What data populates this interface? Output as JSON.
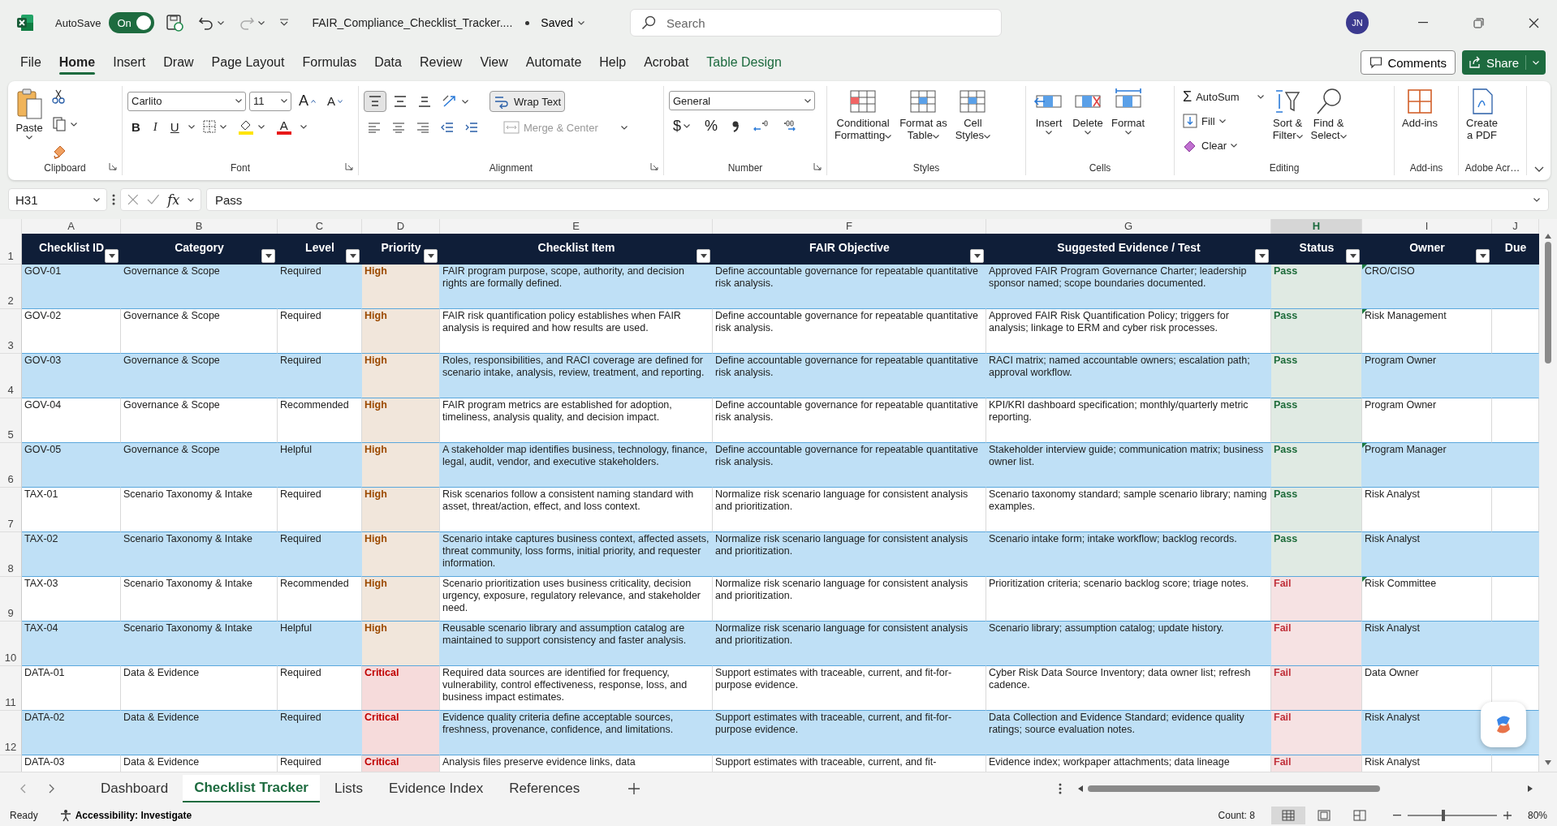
{
  "title_bar": {
    "autosave_label": "AutoSave",
    "autosave": {
      "on": true,
      "label": "On"
    },
    "file_name": "FAIR_Compliance_Checklist_Tracker....",
    "save_status": "Saved",
    "search_placeholder": "Search",
    "avatar_initials": "JN"
  },
  "menu_tabs": [
    {
      "label": "File",
      "selected": false,
      "kind": "standard"
    },
    {
      "label": "Home",
      "selected": true,
      "kind": "standard"
    },
    {
      "label": "Insert",
      "selected": false,
      "kind": "standard"
    },
    {
      "label": "Draw",
      "selected": false,
      "kind": "standard"
    },
    {
      "label": "Page Layout",
      "selected": false,
      "kind": "standard"
    },
    {
      "label": "Formulas",
      "selected": false,
      "kind": "standard"
    },
    {
      "label": "Data",
      "selected": false,
      "kind": "standard"
    },
    {
      "label": "Review",
      "selected": false,
      "kind": "standard"
    },
    {
      "label": "View",
      "selected": false,
      "kind": "standard"
    },
    {
      "label": "Automate",
      "selected": false,
      "kind": "standard"
    },
    {
      "label": "Help",
      "selected": false,
      "kind": "standard"
    },
    {
      "label": "Acrobat",
      "selected": false,
      "kind": "standard"
    },
    {
      "label": "Table Design",
      "selected": false,
      "kind": "contextual"
    }
  ],
  "comments_button": "Comments",
  "share_button": "Share",
  "ribbon": {
    "clipboard": {
      "group": "Clipboard",
      "paste": "Paste"
    },
    "font": {
      "group": "Font",
      "font_name": "Carlito",
      "font_size": "11",
      "grow": "A",
      "shrink": "A",
      "bold": "B",
      "italic": "I",
      "underline": "U",
      "font_color": "A"
    },
    "alignment": {
      "group": "Alignment",
      "vertical_align": [
        {
          "selected": true
        },
        {
          "selected": false
        },
        {
          "selected": false
        }
      ],
      "wrap_text": {
        "label": "Wrap Text",
        "on": true
      },
      "merge": {
        "label": "Merge & Center",
        "disabled": true
      }
    },
    "number": {
      "group": "Number",
      "format": "General",
      "currency": "$",
      "percent": "%"
    },
    "styles": {
      "group": "Styles",
      "buttons": [
        {
          "lines": [
            "Conditional",
            "Formatting"
          ]
        },
        {
          "lines": [
            "Format as",
            "Table"
          ]
        },
        {
          "lines": [
            "Cell",
            "Styles"
          ]
        }
      ]
    },
    "cells": {
      "group": "Cells",
      "buttons": [
        "Insert",
        "Delete",
        "Format"
      ]
    },
    "editing": {
      "group": "Editing",
      "autosum_symbol": "Σ",
      "autosum": "AutoSum",
      "fill": "Fill",
      "clear": "Clear",
      "sort": [
        "Sort &",
        "Filter"
      ],
      "find": [
        "Find &",
        "Select"
      ]
    },
    "addins": {
      "group": "Add-ins",
      "button": "Add-ins"
    },
    "adobe": {
      "group": "Adobe Acr…",
      "button": [
        "Create",
        "a PDF"
      ]
    }
  },
  "formula_bar": {
    "cell": "H31",
    "fx": "fx",
    "value": "Pass"
  },
  "columns": [
    {
      "letter": "A",
      "selected": false
    },
    {
      "letter": "B",
      "selected": false
    },
    {
      "letter": "C",
      "selected": false
    },
    {
      "letter": "D",
      "selected": false
    },
    {
      "letter": "E",
      "selected": false
    },
    {
      "letter": "F",
      "selected": false
    },
    {
      "letter": "G",
      "selected": false
    },
    {
      "letter": "H",
      "selected": true
    },
    {
      "letter": "I",
      "selected": false
    },
    {
      "letter": "J",
      "selected": false
    }
  ],
  "table": {
    "header_row": "1",
    "headers": [
      {
        "label": "Checklist ID",
        "filter": true
      },
      {
        "label": "Category",
        "filter": true
      },
      {
        "label": "Level",
        "filter": true
      },
      {
        "label": "Priority",
        "filter": true
      },
      {
        "label": "Checklist Item",
        "filter": true
      },
      {
        "label": "FAIR Objective",
        "filter": true
      },
      {
        "label": "Suggested Evidence / Test",
        "filter": true
      },
      {
        "label": "Status",
        "filter": true
      },
      {
        "label": "Owner",
        "filter": true
      },
      {
        "label": "Due",
        "filter": false
      }
    ],
    "rows": [
      {
        "row": "2",
        "id": "GOV-01",
        "category": "Governance & Scope",
        "level": "Required",
        "priority": {
          "text": "High",
          "color": "#9c4a00"
        },
        "item": "FAIR program purpose, scope, authority, and decision rights are formally defined.",
        "objective": "Define accountable governance for repeatable quantitative risk analysis.",
        "evidence": "Approved FAIR Program Governance Charter; leadership sponsor named; scope boundaries documented.",
        "status": {
          "text": "Pass",
          "color": "#1e6b3a"
        },
        "owner": "CRO/CISO",
        "note": true
      },
      {
        "row": "3",
        "id": "GOV-02",
        "category": "Governance & Scope",
        "level": "Required",
        "priority": {
          "text": "High",
          "color": "#9c4a00"
        },
        "item": "FAIR risk quantification policy establishes when FAIR analysis is required and how results are used.",
        "objective": "Define accountable governance for repeatable quantitative risk analysis.",
        "evidence": "Approved FAIR Risk Quantification Policy; triggers for analysis; linkage to ERM and cyber risk processes.",
        "status": {
          "text": "Pass",
          "color": "#1e6b3a"
        },
        "owner": "Risk Management",
        "note": true
      },
      {
        "row": "4",
        "id": "GOV-03",
        "category": "Governance & Scope",
        "level": "Required",
        "priority": {
          "text": "High",
          "color": "#9c4a00"
        },
        "item": "Roles, responsibilities, and RACI coverage are defined for scenario intake, analysis, review, treatment, and reporting.",
        "objective": "Define accountable governance for repeatable quantitative risk analysis.",
        "evidence": "RACI matrix; named accountable owners; escalation path; approval workflow.",
        "status": {
          "text": "Pass",
          "color": "#1e6b3a"
        },
        "owner": "Program Owner",
        "note": false
      },
      {
        "row": "5",
        "id": "GOV-04",
        "category": "Governance & Scope",
        "level": "Recommended",
        "priority": {
          "text": "High",
          "color": "#9c4a00"
        },
        "item": "FAIR program metrics are established for adoption, timeliness, analysis quality, and decision impact.",
        "objective": "Define accountable governance for repeatable quantitative risk analysis.",
        "evidence": "KPI/KRI dashboard specification; monthly/quarterly metric reporting.",
        "status": {
          "text": "Pass",
          "color": "#1e6b3a"
        },
        "owner": "Program Owner",
        "note": false
      },
      {
        "row": "6",
        "id": "GOV-05",
        "category": "Governance & Scope",
        "level": "Helpful",
        "priority": {
          "text": "High",
          "color": "#9c4a00"
        },
        "item": "A stakeholder map identifies business, technology, finance, legal, audit, vendor, and executive stakeholders.",
        "objective": "Define accountable governance for repeatable quantitative risk analysis.",
        "evidence": "Stakeholder interview guide; communication matrix; business owner list.",
        "status": {
          "text": "Pass",
          "color": "#1e6b3a"
        },
        "owner": "Program Manager",
        "note": true
      },
      {
        "row": "7",
        "id": "TAX-01",
        "category": "Scenario Taxonomy & Intake",
        "level": "Required",
        "priority": {
          "text": "High",
          "color": "#9c4a00"
        },
        "item": "Risk scenarios follow a consistent naming standard with asset, threat/action, effect, and loss context.",
        "objective": "Normalize risk scenario language for consistent analysis and prioritization.",
        "evidence": "Scenario taxonomy standard; sample scenario library; naming examples.",
        "status": {
          "text": "Pass",
          "color": "#1e6b3a"
        },
        "owner": "Risk Analyst",
        "note": false
      },
      {
        "row": "8",
        "id": "TAX-02",
        "category": "Scenario Taxonomy & Intake",
        "level": "Required",
        "priority": {
          "text": "High",
          "color": "#9c4a00"
        },
        "item": "Scenario intake captures business context, affected assets, threat community, loss forms, initial priority, and requester information.",
        "objective": "Normalize risk scenario language for consistent analysis and prioritization.",
        "evidence": "Scenario intake form; intake workflow; backlog records.",
        "status": {
          "text": "Pass",
          "color": "#1e6b3a"
        },
        "owner": "Risk Analyst",
        "note": false
      },
      {
        "row": "9",
        "id": "TAX-03",
        "category": "Scenario Taxonomy & Intake",
        "level": "Recommended",
        "priority": {
          "text": "High",
          "color": "#9c4a00"
        },
        "item": "Scenario prioritization uses business criticality, decision urgency, exposure, regulatory relevance, and stakeholder need.",
        "objective": "Normalize risk scenario language for consistent analysis and prioritization.",
        "evidence": "Prioritization criteria; scenario backlog score; triage notes.",
        "status": {
          "text": "Fail",
          "color": "#c0303a"
        },
        "owner": "Risk Committee",
        "note": true
      },
      {
        "row": "10",
        "id": "TAX-04",
        "category": "Scenario Taxonomy & Intake",
        "level": "Helpful",
        "priority": {
          "text": "High",
          "color": "#9c4a00"
        },
        "item": "Reusable scenario library and assumption catalog are maintained to support consistency and faster analysis.",
        "objective": "Normalize risk scenario language for consistent analysis and prioritization.",
        "evidence": "Scenario library; assumption catalog; update history.",
        "status": {
          "text": "Fail",
          "color": "#c0303a"
        },
        "owner": "Risk Analyst",
        "note": false
      },
      {
        "row": "11",
        "id": "DATA-01",
        "category": "Data & Evidence",
        "level": "Required",
        "priority": {
          "text": "Critical",
          "color": "#c00000"
        },
        "item": "Required data sources are identified for frequency, vulnerability, control effectiveness, response, loss, and business impact estimates.",
        "objective": "Support estimates with traceable, current, and fit-for-purpose evidence.",
        "evidence": "Cyber Risk Data Source Inventory; data owner list; refresh cadence.",
        "status": {
          "text": "Fail",
          "color": "#c0303a"
        },
        "owner": "Data Owner",
        "note": false
      },
      {
        "row": "12",
        "id": "DATA-02",
        "category": "Data & Evidence",
        "level": "Required",
        "priority": {
          "text": "Critical",
          "color": "#c00000"
        },
        "item": "Evidence quality criteria define acceptable sources, freshness, provenance, confidence, and limitations.",
        "objective": "Support estimates with traceable, current, and fit-for-purpose evidence.",
        "evidence": "Data Collection and Evidence Standard; evidence quality ratings; source evaluation notes.",
        "status": {
          "text": "Fail",
          "color": "#c0303a"
        },
        "owner": "Risk Analyst",
        "note": false
      },
      {
        "id": "DATA-03",
        "category": "Data & Evidence",
        "level": "Required",
        "priority": {
          "text": "Critical",
          "color": "#c00000"
        },
        "item": "Analysis files preserve evidence links, data",
        "objective": "Support estimates with traceable, current, and fit-",
        "evidence": "Evidence index; workpaper attachments; data lineage",
        "status": {
          "text": "Fail",
          "color": "#c0303a"
        },
        "owner": "Risk Analyst",
        "note": false
      }
    ]
  },
  "sheet_tabs": [
    {
      "label": "Dashboard",
      "selected": false
    },
    {
      "label": "Checklist Tracker",
      "selected": true
    },
    {
      "label": "Lists",
      "selected": false
    },
    {
      "label": "Evidence Index",
      "selected": false
    },
    {
      "label": "References",
      "selected": false
    }
  ],
  "status_bar": {
    "ready": "Ready",
    "accessibility": "Accessibility: Investigate",
    "count": "Count: 8",
    "views": [
      {
        "selected": true
      },
      {
        "selected": false
      },
      {
        "selected": false
      }
    ],
    "zoom_slider": {
      "level": 0.4
    },
    "zoom": "80%"
  }
}
